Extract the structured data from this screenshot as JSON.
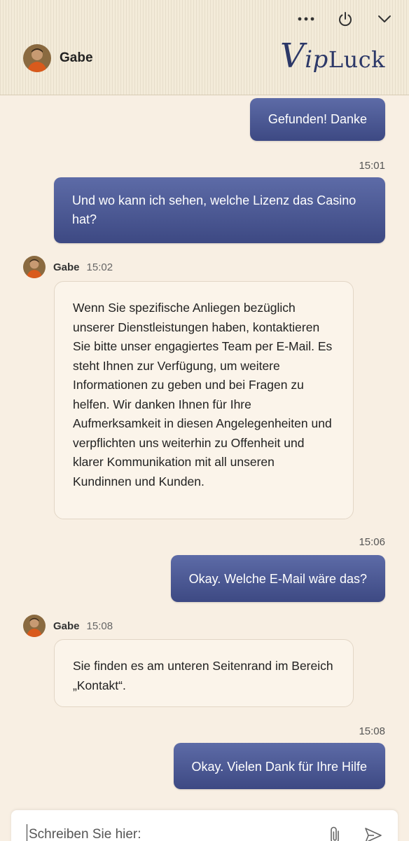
{
  "header": {
    "agent_name": "Gabe",
    "brand": {
      "v": "V",
      "ip": "ip",
      "luck": "Luck"
    },
    "icons": [
      "more-icon",
      "power-icon",
      "chevron-down-icon"
    ]
  },
  "messages": [
    {
      "from": "user",
      "text": "Gefunden! Danke"
    },
    {
      "from": "user",
      "time": "15:01",
      "text": "Und wo kann ich sehen, welche Lizenz das Casino hat?"
    },
    {
      "from": "agent",
      "name": "Gabe",
      "time": "15:02",
      "text": "Wenn Sie spezifische Anliegen bezüglich unserer Dienstleistungen haben, kontaktieren Sie bitte unser engagiertes Team per E-Mail. Es steht Ihnen zur Verfügung, um weitere Informationen zu geben und bei Fragen zu helfen. Wir danken Ihnen für Ihre Aufmerksamkeit in diesen Angelegenheiten und verpflichten uns weiterhin zu Offenheit und klarer Kommunikation mit all unseren Kundinnen und Kunden."
    },
    {
      "from": "user",
      "time": "15:06",
      "text": "Okay. Welche E-Mail wäre das?"
    },
    {
      "from": "agent",
      "name": "Gabe",
      "time": "15:08",
      "text": "Sie finden es am unteren Seitenrand im Bereich „Kontakt“."
    },
    {
      "from": "user",
      "time": "15:08",
      "text": "Okay. Vielen Dank für Ihre Hilfe"
    }
  ],
  "composer": {
    "placeholder": "Schreiben Sie hier:",
    "icons": [
      "paperclip-icon",
      "send-icon"
    ]
  },
  "colors": {
    "background": "#f8efe3",
    "user_bubble_top": "#5d6ba7",
    "user_bubble_bottom": "#3d4983",
    "brand": "#2c3868"
  }
}
